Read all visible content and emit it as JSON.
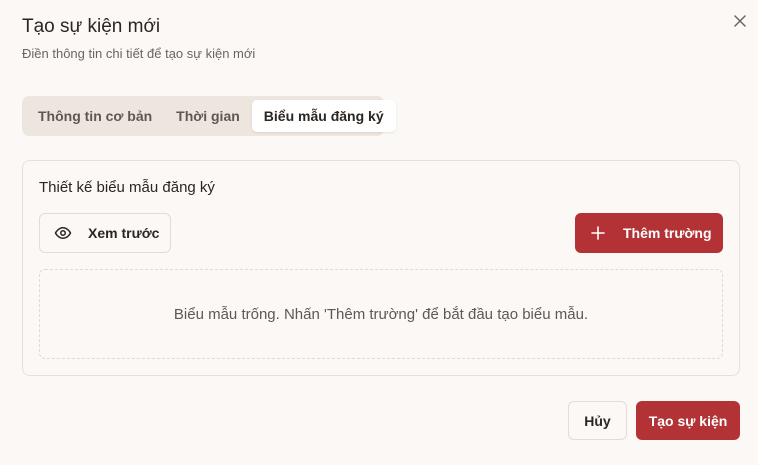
{
  "dialog": {
    "title": "Tạo sự kiện mới",
    "subtitle": "Điền thông tin chi tiết để tạo sự kiện mới",
    "close_icon": "close-icon"
  },
  "tabs": [
    {
      "label": "Thông tin cơ bản",
      "active": false
    },
    {
      "label": "Thời gian",
      "active": false
    },
    {
      "label": "Biểu mẫu đăng ký",
      "active": true
    }
  ],
  "form_designer": {
    "title": "Thiết kế biểu mẫu đăng ký",
    "preview_label": "Xem trước",
    "preview_icon": "eye-icon",
    "add_field_label": "Thêm trường",
    "add_field_icon": "plus-icon",
    "empty_message": "Biểu mẫu trống. Nhấn 'Thêm trường' để bắt đầu tạo biểu mẫu."
  },
  "footer": {
    "cancel_label": "Hủy",
    "create_label": "Tạo sự kiện"
  },
  "colors": {
    "accent": "#b23236",
    "background": "#fbf8f5",
    "tab_track": "#ece6df"
  }
}
